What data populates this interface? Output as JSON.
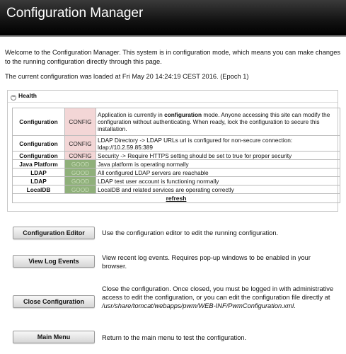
{
  "header": {
    "title": "Configuration Manager"
  },
  "intro": {
    "welcome": "Welcome to the Configuration Manager. This system is in configuration mode, which means you can make changes to the running configuration directly through this page.",
    "loaded": "The current configuration was loaded at Fri May 20 14:24:19 CEST 2016. (Epoch 1)"
  },
  "health": {
    "heading": "Health",
    "rows": [
      {
        "label": "Configuration",
        "status": "CONFIG",
        "desc_pre": "Application is currently in ",
        "desc_bold": "configuration",
        "desc_post": " mode. Anyone accessing this site can modify the configuration without authenticating. When ready, lock the configuration to secure this installation."
      },
      {
        "label": "Configuration",
        "status": "CONFIG",
        "desc": "LDAP Directory -> LDAP URLs url is configured for non-secure connection: ldap://10.2.59.85:389"
      },
      {
        "label": "Configuration",
        "status": "CONFIG",
        "desc": "Security -> Require HTTPS setting should be set to true for proper security"
      },
      {
        "label": "Java Platform",
        "status": "GOOD",
        "desc": "Java platform is operating normally"
      },
      {
        "label": "LDAP",
        "status": "GOOD",
        "desc": "All configured LDAP servers are reachable"
      },
      {
        "label": "LDAP",
        "status": "GOOD",
        "desc": "LDAP test user account is functioning normally"
      },
      {
        "label": "LocalDB",
        "status": "GOOD",
        "desc": "LocalDB and related services are operating correctly"
      }
    ],
    "refresh": "refresh"
  },
  "actions": {
    "editor": {
      "label": "Configuration Editor",
      "desc": "Use the configuration editor to edit the running configuration."
    },
    "log": {
      "label": "View Log Events",
      "desc": "View recent log events. Requires pop-up windows to be enabled in your browser."
    },
    "close": {
      "label": "Close Configuration",
      "desc_pre": "Close the configuration. Once closed, you must be logged in with administrative access to edit the configuration, or you can edit the configuration file directly at ",
      "desc_path": "/usr/share/tomcat/webapps/pwm/WEB-INF/PwmConfiguration.xml",
      "desc_post": "."
    },
    "menu": {
      "label": "Main Menu",
      "desc": "Return to the main menu to test the configuration."
    }
  }
}
